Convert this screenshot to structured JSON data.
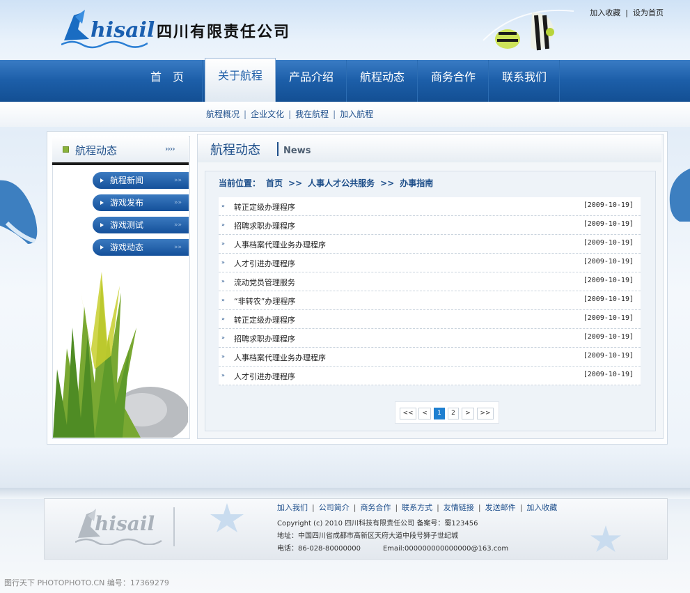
{
  "header": {
    "logo_text": "hisail",
    "company_name": "四川有限责任公司",
    "top_links": [
      "加入收藏",
      "设为首页"
    ]
  },
  "nav": {
    "items": [
      "首　页",
      "关于航程",
      "产品介绍",
      "航程动态",
      "商务合作",
      "联系我们"
    ],
    "active_index": 1,
    "sub_items": [
      "航程概况",
      "企业文化",
      "我在航程",
      "加入航程"
    ]
  },
  "sidebar": {
    "title": "航程动态",
    "arrows": "››››",
    "items": [
      {
        "label": "航程新闻",
        "dots": "»»"
      },
      {
        "label": "游戏发布",
        "dots": "»»"
      },
      {
        "label": "游戏测试",
        "dots": "»»"
      },
      {
        "label": "游戏动态",
        "dots": "»»"
      }
    ]
  },
  "content": {
    "title": "航程动态",
    "title_en": "News",
    "breadcrumb": [
      "当前位置：",
      "首页",
      ">>",
      "人事人才公共服务",
      ">>",
      "办事指南"
    ],
    "rows": [
      {
        "title": "转正定级办理程序",
        "date": "[2009-10-19]"
      },
      {
        "title": "招聘求职办理程序",
        "date": "[2009-10-19]"
      },
      {
        "title": "人事档案代理业务办理程序",
        "date": "[2009-10-19]"
      },
      {
        "title": "人才引进办理程序",
        "date": "[2009-10-19]"
      },
      {
        "title": "流动党员管理服务",
        "date": "[2009-10-19]"
      },
      {
        "title": "“非转农”办理程序",
        "date": "[2009-10-19]"
      },
      {
        "title": "转正定级办理程序",
        "date": "[2009-10-19]"
      },
      {
        "title": "招聘求职办理程序",
        "date": "[2009-10-19]"
      },
      {
        "title": "人事档案代理业务办理程序",
        "date": "[2009-10-19]"
      },
      {
        "title": "人才引进办理程序",
        "date": "[2009-10-19]"
      }
    ],
    "pager": [
      "<<",
      "<",
      "1",
      "2",
      ">",
      ">>"
    ],
    "current_page": "1"
  },
  "footer": {
    "logo_text": "hisail",
    "links": [
      "加入我们",
      "公司简介",
      "商务合作",
      "联系方式",
      "友情链接",
      "发送邮件",
      "加入收藏"
    ],
    "copyright": "Copyright (c) 2010 四川科技有限责任公司 备案号：蜀123456",
    "address": "地址：中国四川省成都市高新区天府大道中段号狮子世纪城",
    "tel": "电话：86-028-80000000",
    "email": "Email:000000000000000@163.com"
  },
  "watermark": "图行天下 PHOTOPHOTO.CN  编号：17369279",
  "colors": {
    "nav_blue": "#1c5ea8",
    "accent_blue": "#1e4f8a",
    "page_current": "#1e7fd0",
    "bullet_green": "#8ab33a"
  }
}
